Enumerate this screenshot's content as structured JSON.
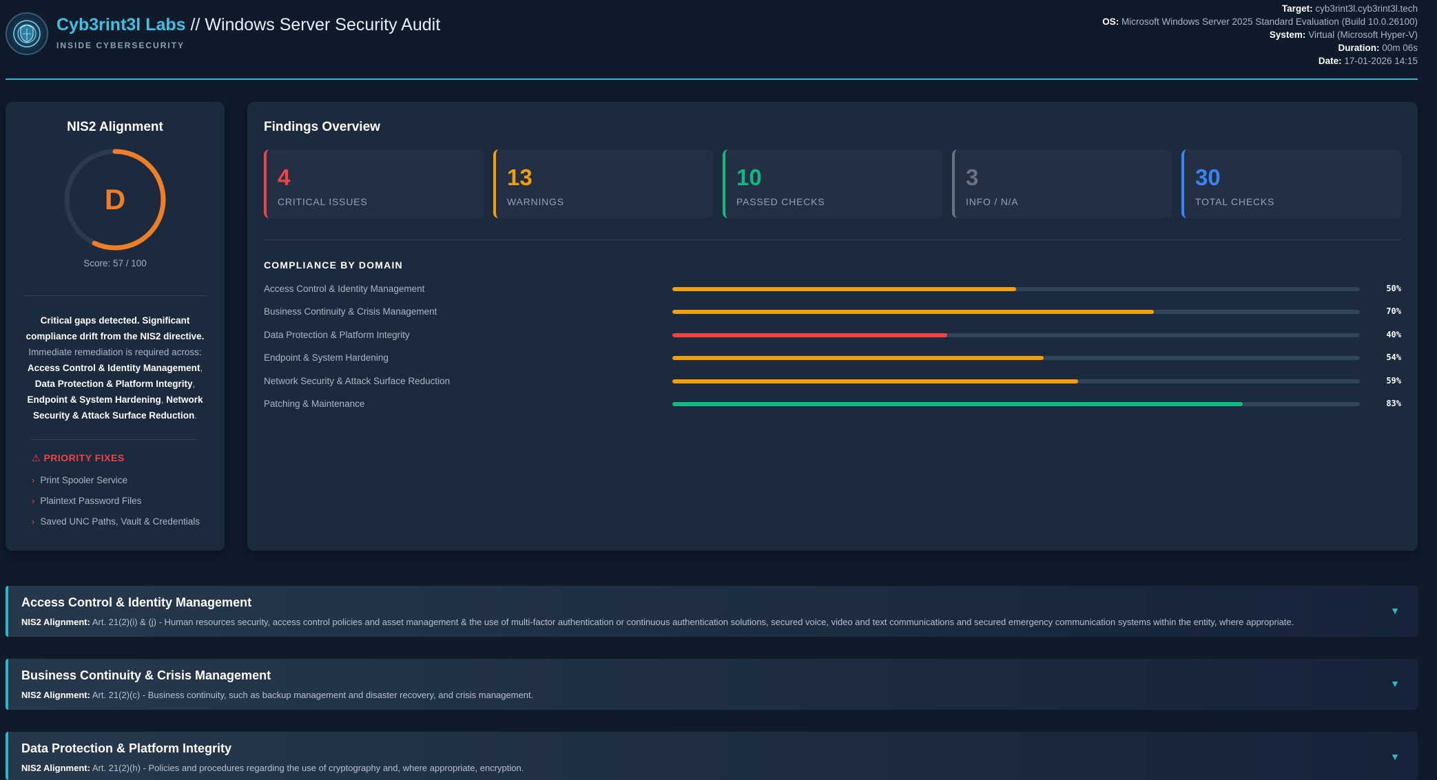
{
  "header": {
    "brand": "Cyb3rint3l Labs",
    "title_suffix": " // Windows Server Security Audit",
    "tagline": "INSIDE CYBERSECURITY",
    "meta": [
      {
        "label": "Target:",
        "value": "cyb3rint3l.cyb3rint3l.tech"
      },
      {
        "label": "OS:",
        "value": "Microsoft Windows Server 2025 Standard Evaluation (Build 10.0.26100)"
      },
      {
        "label": "System:",
        "value": "Virtual (Microsoft Hyper-V)"
      },
      {
        "label": "Duration:",
        "value": "00m 06s"
      },
      {
        "label": "Date:",
        "value": "17-01-2026 14:15"
      }
    ]
  },
  "nis2": {
    "title": "NIS2 Alignment",
    "grade": "D",
    "score": 57,
    "score_text": "Score: 57 / 100",
    "gauge_color": "#ee7f26",
    "summary_lead": "Critical gaps detected. Significant compliance drift from the NIS2 directive.",
    "summary_mid": "Immediate remediation is required across:",
    "summary_domains": [
      "Access Control & Identity Management",
      "Data Protection & Platform Integrity",
      "Endpoint & System Hardening",
      "Network Security & Attack Surface Reduction"
    ],
    "priority_title": "PRIORITY FIXES",
    "priority_fixes": [
      "Print Spooler Service",
      "Plaintext Password Files",
      "Saved UNC Paths, Vault & Credentials"
    ]
  },
  "findings": {
    "title": "Findings Overview",
    "stats": [
      {
        "value": "4",
        "label": "CRITICAL ISSUES",
        "color": "#ef4444"
      },
      {
        "value": "13",
        "label": "WARNINGS",
        "color": "#f59e0b"
      },
      {
        "value": "10",
        "label": "PASSED CHECKS",
        "color": "#10b981"
      },
      {
        "value": "3",
        "label": "INFO / N/A",
        "color": "#6b7280"
      },
      {
        "value": "30",
        "label": "TOTAL CHECKS",
        "color": "#3b82f6"
      }
    ],
    "compliance_title": "COMPLIANCE BY DOMAIN",
    "domains": [
      {
        "name": "Access Control & Identity Management",
        "percent": 50,
        "color": "#f59e0b"
      },
      {
        "name": "Business Continuity & Crisis Management",
        "percent": 70,
        "color": "#f59e0b"
      },
      {
        "name": "Data Protection & Platform Integrity",
        "percent": 40,
        "color": "#ef4444"
      },
      {
        "name": "Endpoint & System Hardening",
        "percent": 54,
        "color": "#f59e0b"
      },
      {
        "name": "Network Security & Attack Surface Reduction",
        "percent": 59,
        "color": "#f59e0b"
      },
      {
        "name": "Patching & Maintenance",
        "percent": 83,
        "color": "#10b981"
      }
    ]
  },
  "sections": [
    {
      "title": "Access Control & Identity Management",
      "label": "NIS2 Alignment:",
      "desc": "Art. 21(2)(i) & (j) - Human resources security, access control policies and asset management & the use of multi-factor authentication or continuous authentication solutions, secured voice, video and text communications and secured emergency communication systems within the entity, where appropriate.",
      "toggle": "▼"
    },
    {
      "title": "Business Continuity & Crisis Management",
      "label": "NIS2 Alignment:",
      "desc": "Art. 21(2)(c) - Business continuity, such as backup management and disaster recovery, and crisis management.",
      "toggle": "▼"
    },
    {
      "title": "Data Protection & Platform Integrity",
      "label": "NIS2 Alignment:",
      "desc": "Art. 21(2)(h) - Policies and procedures regarding the use of cryptography and, where appropriate, encryption.",
      "toggle": "▼"
    }
  ]
}
